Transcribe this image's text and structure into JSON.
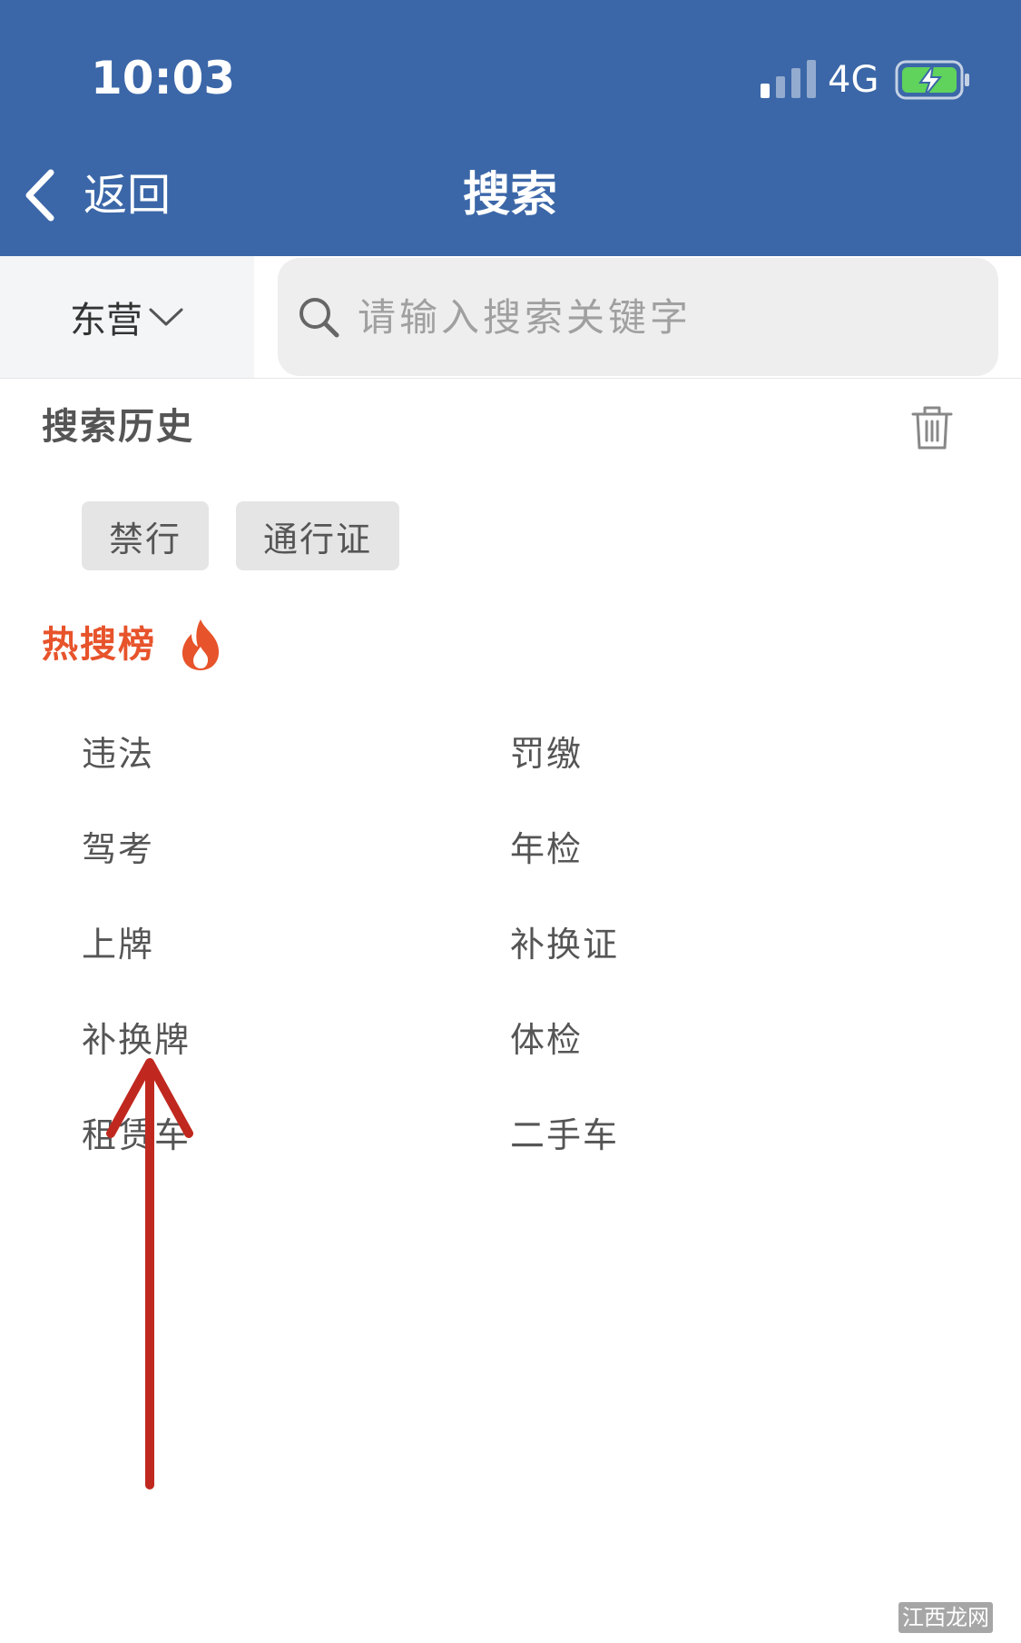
{
  "status_bar": {
    "time": "10:03",
    "network": "4G",
    "icons": [
      "signal-icon",
      "battery-charging-icon"
    ]
  },
  "nav": {
    "back_label": "返回",
    "title": "搜索"
  },
  "search": {
    "city": "东营",
    "placeholder": "请输入搜索关键字",
    "value": ""
  },
  "history": {
    "title": "搜索历史",
    "tags": [
      "禁行",
      "通行证"
    ]
  },
  "hot": {
    "title": "热搜榜",
    "items": [
      "违法",
      "罚缴",
      "驾考",
      "年检",
      "上牌",
      "补换证",
      "补换牌",
      "体检",
      "租赁车",
      "二手车"
    ]
  },
  "colors": {
    "header": "#3b67a8",
    "hot_accent": "#e7532b",
    "annotation_arrow": "#c0281f"
  },
  "watermark": "江西龙网"
}
